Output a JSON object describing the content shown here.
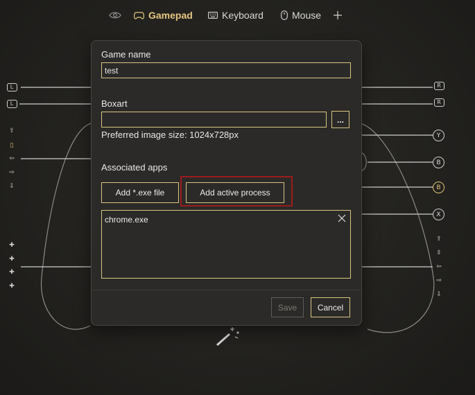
{
  "tabs": [
    {
      "label": "",
      "icon": "eye-icon"
    },
    {
      "label": "Gamepad",
      "icon": "gamepad-icon",
      "active": true
    },
    {
      "label": "Keyboard",
      "icon": "keyboard-icon"
    },
    {
      "label": "Mouse",
      "icon": "mouse-icon"
    },
    {
      "label": "",
      "icon": "plus-icon"
    }
  ],
  "controller": {
    "left_labels": [
      "L",
      "L"
    ],
    "right_labels": [
      "R",
      "R"
    ],
    "face_buttons": [
      "Y",
      "B",
      "B",
      "X"
    ]
  },
  "dialog": {
    "game_name_label": "Game name",
    "game_name_value": "test",
    "boxart_label": "Boxart",
    "boxart_value": "",
    "browse_label": "...",
    "image_size_hint": "Preferred image size: 1024x728px",
    "associated_apps_label": "Associated apps",
    "add_exe_label": "Add *.exe file",
    "add_process_label": "Add active process",
    "apps": [
      "chrome.exe"
    ],
    "save_label": "Save",
    "cancel_label": "Cancel"
  },
  "colors": {
    "accent": "#dcc583",
    "highlight": "#9c1c1c",
    "dialog_bg": "#2b2a28"
  }
}
